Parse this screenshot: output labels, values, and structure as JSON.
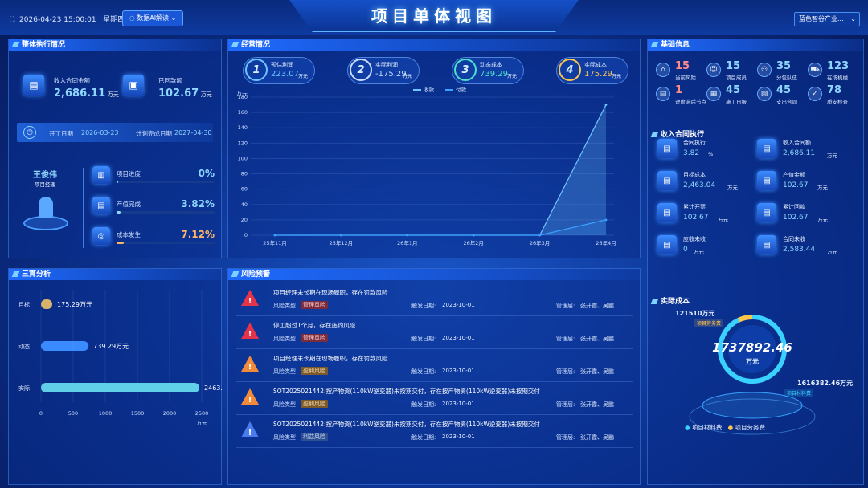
{
  "header": {
    "datetime": "2026-04-23 15:00:01",
    "weekday": "星期四",
    "ai_button": "数据AI解读",
    "title": "项目单体视图",
    "project_select": "蓝色智谷产业..."
  },
  "execution": {
    "title": "整体执行情况",
    "contract_label": "收入合同金额",
    "contract_value": "2,686.11",
    "contract_unit": "万元",
    "returned_label": "已回款额",
    "returned_value": "102.67",
    "returned_unit": "万元",
    "start_label": "开工日期",
    "start_date": "2026-03-23",
    "finish_label": "计划完成日期",
    "finish_date": "2027-04-30",
    "manager_name": "王俊伟",
    "manager_role": "项目经理",
    "metrics": [
      {
        "label": "项目进度",
        "value": "0%",
        "progress": 0
      },
      {
        "label": "产值完成",
        "value": "3.82%",
        "progress": 0.0382
      },
      {
        "label": "成本发生",
        "value": "7.12%",
        "progress": 0.0712
      }
    ]
  },
  "operating": {
    "title": "经营情况",
    "kpis": [
      {
        "index": "1",
        "label": "预估利润",
        "value": "223.07",
        "unit": "万元"
      },
      {
        "index": "2",
        "label": "实际利润",
        "value": "-175.29",
        "unit": "万元"
      },
      {
        "index": "3",
        "label": "动态成本",
        "value": "739.29",
        "unit": "万元"
      },
      {
        "index": "4",
        "label": "实际成本",
        "value": "175.29",
        "unit": "万元"
      }
    ]
  },
  "chart_data": {
    "type": "area",
    "ylabel": "万元",
    "ylim": [
      0,
      180
    ],
    "yticks": [
      0,
      20,
      40,
      60,
      80,
      100,
      120,
      140,
      160,
      180
    ],
    "categories": [
      "25年11月",
      "25年12月",
      "26年1月",
      "26年2月",
      "26年3月",
      "26年4月"
    ],
    "series": [
      {
        "name": "收款",
        "values": [
          0,
          0,
          0,
          0,
          0,
          170
        ]
      },
      {
        "name": "付款",
        "values": [
          0,
          0,
          0,
          0,
          0,
          20
        ]
      }
    ],
    "legend": "top-center",
    "colors": [
      "#6fc4ff",
      "#3aa0ff"
    ]
  },
  "three_calc": {
    "title": "三算分析",
    "rows": [
      {
        "label": "目标",
        "value": 175.29,
        "text": "175.29万元"
      },
      {
        "label": "动态",
        "value": 739.29,
        "text": "739.29万元"
      },
      {
        "label": "实际",
        "value": 2463,
        "text": "2463."
      }
    ],
    "xticks": [
      "0",
      "500",
      "1000",
      "1500",
      "2000",
      "2500"
    ],
    "xunit": "万元",
    "xmax": 2500
  },
  "risk": {
    "title": "风险预警",
    "type_label": "风险类型",
    "date_label": "触发日期:",
    "person_label": "管理层:",
    "items": [
      {
        "level": "red",
        "text": "项目经理未长期在现场履职，存在罚款风险",
        "type": "管理风险",
        "date": "2023-10-01",
        "persons": "张开霞、吴鹏"
      },
      {
        "level": "red",
        "text": "停工超过1个月，存在违约风险",
        "type": "管理风险",
        "date": "2023-10-01",
        "persons": "张开霞、吴鹏"
      },
      {
        "level": "orange",
        "text": "项目经理未长期在现场履职，存在罚款风险",
        "type": "盈利风险",
        "date": "2023-10-01",
        "persons": "张开霞、吴鹏"
      },
      {
        "level": "orange",
        "text": "SOT2025021442:按产物资(110kW逆变器)未按期交付，存在按产物资(110kW逆变器)未按期交付",
        "type": "盈利风险",
        "date": "2023-10-01",
        "persons": "张开霞、吴鹏"
      },
      {
        "level": "blue",
        "text": "SOT2025021442:按产物资(110kW逆变器)未按期交付，存在按产物资(110kW逆变器)未按期交付",
        "type": "利益风险",
        "date": "2023-10-01",
        "persons": "张开霞、吴鹏"
      }
    ]
  },
  "basic": {
    "title": "基础信息",
    "cells": [
      {
        "num": "15",
        "label": "当前风险",
        "icon": "house-icon"
      },
      {
        "num": "15",
        "label": "项目成员",
        "icon": "person-icon"
      },
      {
        "num": "35",
        "label": "分包队伍",
        "icon": "team-icon"
      },
      {
        "num": "123",
        "label": "在场机械",
        "icon": "truck-icon"
      },
      {
        "num": "1",
        "label": "进度滞后节点",
        "icon": "doc-icon"
      },
      {
        "num": "45",
        "label": "施工日报",
        "icon": "report-icon"
      },
      {
        "num": "45",
        "label": "支出合同",
        "icon": "contract-icon"
      },
      {
        "num": "78",
        "label": "质安检查",
        "icon": "check-icon"
      }
    ]
  },
  "income": {
    "title": "收入合同执行",
    "cells": [
      {
        "label": "合同执行",
        "value": "3.82",
        "unit": "%"
      },
      {
        "label": "收入合同额",
        "value": "2,686.11",
        "unit": "万元"
      },
      {
        "label": "目标成本",
        "value": "2,463.04",
        "unit": "万元"
      },
      {
        "label": "产值金额",
        "value": "102.67",
        "unit": "万元"
      },
      {
        "label": "累计开票",
        "value": "102.67",
        "unit": "万元"
      },
      {
        "label": "累计回款",
        "value": "102.67",
        "unit": "万元"
      },
      {
        "label": "应收未收",
        "value": "0",
        "unit": "万元"
      },
      {
        "label": "合同未收",
        "value": "2,583.44",
        "unit": "万元"
      }
    ]
  },
  "actual_cost": {
    "title": "实际成本",
    "total": "1737892.46",
    "unit": "万元",
    "labor_value": "121510万元",
    "labor_label": "项目劳务费",
    "material_value": "1616382.46万元",
    "material_label": "项目材料费",
    "legend": [
      "项目材料费",
      "项目劳务费"
    ],
    "colors": [
      "#3ad1ff",
      "#ffc64a"
    ]
  }
}
